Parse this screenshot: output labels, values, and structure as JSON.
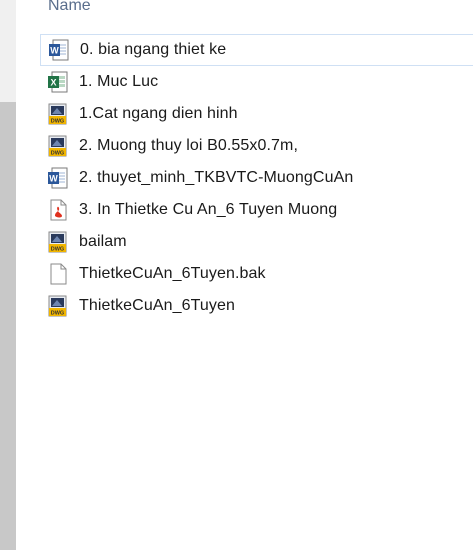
{
  "header": {
    "name_column": "Name"
  },
  "files": [
    {
      "name": "0. bia ngang thiet ke",
      "icon": "word-doc-icon",
      "selected": true
    },
    {
      "name": "1. Muc Luc",
      "icon": "excel-sheet-icon",
      "selected": false
    },
    {
      "name": "1.Cat ngang dien hinh",
      "icon": "dwg-file-icon",
      "selected": false
    },
    {
      "name": "2. Muong thuy loi B0.55x0.7m,",
      "icon": "dwg-file-icon",
      "selected": false
    },
    {
      "name": "2. thuyet_minh_TKBVTC-MuongCuAn",
      "icon": "word-doc-icon",
      "selected": false
    },
    {
      "name": "3. In Thietke Cu An_6 Tuyen Muong",
      "icon": "pdf-file-icon",
      "selected": false
    },
    {
      "name": "bailam",
      "icon": "dwg-file-icon",
      "selected": false
    },
    {
      "name": "ThietkeCuAn_6Tuyen.bak",
      "icon": "blank-file-icon",
      "selected": false
    },
    {
      "name": "ThietkeCuAn_6Tuyen",
      "icon": "dwg-file-icon",
      "selected": false
    }
  ],
  "colors": {
    "word": "#2b579a",
    "excel": "#217346",
    "dwg_banner": "#f2b600",
    "pdf": "#e0301e"
  },
  "icon_labels": {
    "dwg": "DWG"
  }
}
